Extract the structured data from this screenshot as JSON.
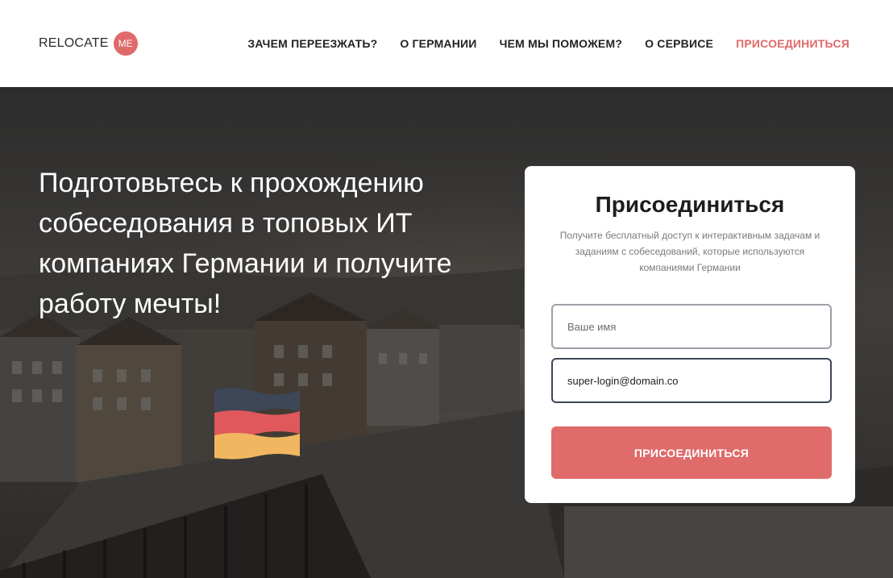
{
  "header": {
    "logo_text": "RELOCATE",
    "logo_badge": "ME",
    "nav": [
      {
        "label": "ЗАЧЕМ ПЕРЕЕЗЖАТЬ?"
      },
      {
        "label": "О ГЕРМАНИИ"
      },
      {
        "label": "ЧЕМ МЫ ПОМОЖЕМ?"
      },
      {
        "label": "О СЕРВИСЕ"
      },
      {
        "label": "ПРИСОЕДИНИТЬСЯ"
      }
    ]
  },
  "hero": {
    "title": "Подготовьтесь к прохождению собеседования в топовых ИТ компаниях Германии и получите работу мечты!",
    "flag_icon": "germany-flag-icon"
  },
  "form": {
    "title": "Присоединиться",
    "subtitle": "Получите бесплатный доступ к интерактивным задачам и заданиям с собеседований, которые используются компаниями Германии",
    "name_placeholder": "Ваше имя",
    "name_value": "",
    "email_value": "super-login@domain.co",
    "submit_label": "ПРИСОЕДИНИТЬСЯ"
  },
  "colors": {
    "accent": "#e06a6a",
    "text_dark": "#222222",
    "flag_top": "#3d4757",
    "flag_middle": "#e0585b",
    "flag_bottom": "#f0b760"
  }
}
